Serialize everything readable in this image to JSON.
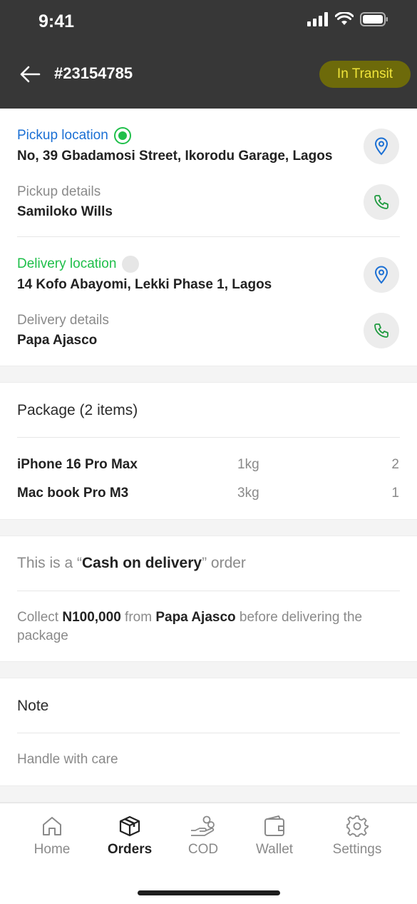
{
  "status_bar": {
    "time": "9:41"
  },
  "header": {
    "order_id": "#23154785",
    "status": "In Transit",
    "status_bg": "#6d6a0a",
    "status_fg": "#f0e43a"
  },
  "pickup": {
    "label": "Pickup location",
    "address": "No, 39 Gbadamosi Street, Ikorodu Garage, Lagos",
    "details_label": "Pickup details",
    "contact": "Samiloko Wills",
    "label_color": "#1a6fd4"
  },
  "delivery": {
    "label": "Delivery location",
    "address": "14 Kofo Abayomi, Lekki Phase 1, Lagos",
    "details_label": "Delivery details",
    "contact": "Papa Ajasco",
    "label_color": "#1fbf4a"
  },
  "package": {
    "title": "Package (2 items)",
    "items": [
      {
        "name": "iPhone 16 Pro Max",
        "weight": "1kg",
        "qty": "2"
      },
      {
        "name": "Mac book Pro M3",
        "weight": "3kg",
        "qty": "1"
      }
    ]
  },
  "cod": {
    "prefix": "This is a “",
    "highlight": "Cash on delivery",
    "suffix": "” order",
    "collect_prefix": "Collect ",
    "amount": "N100,000",
    "collect_mid": " from ",
    "recipient": "Papa Ajasco",
    "collect_suffix": " before delivering the package"
  },
  "note": {
    "title": "Note",
    "text": "Handle with care"
  },
  "tabs": [
    {
      "label": "Home",
      "icon": "home-icon"
    },
    {
      "label": "Orders",
      "icon": "box-icon"
    },
    {
      "label": "COD",
      "icon": "cash-hand-icon"
    },
    {
      "label": "Wallet",
      "icon": "wallet-icon"
    },
    {
      "label": "Settings",
      "icon": "gear-icon"
    }
  ]
}
